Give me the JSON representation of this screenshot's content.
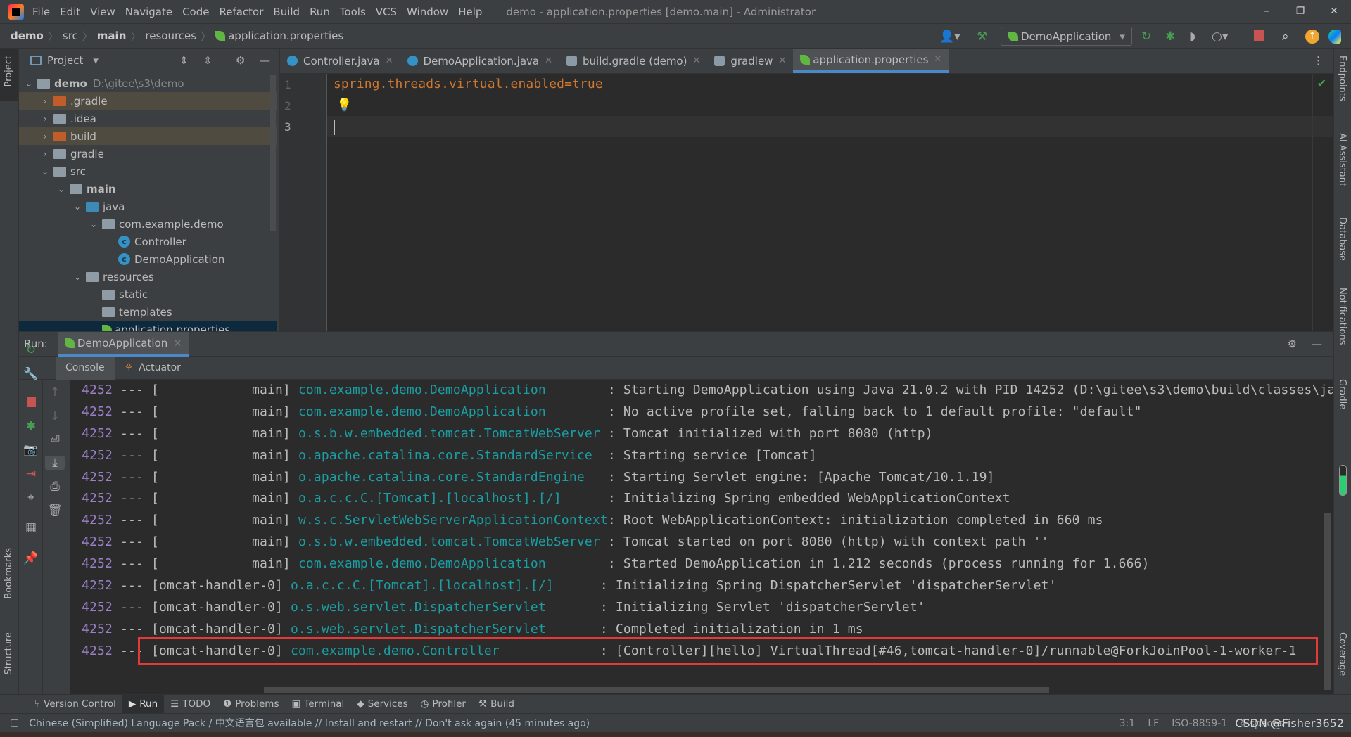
{
  "window": {
    "title": "demo - application.properties [demo.main] - Administrator",
    "menu": [
      "File",
      "Edit",
      "View",
      "Navigate",
      "Code",
      "Refactor",
      "Build",
      "Run",
      "Tools",
      "VCS",
      "Window",
      "Help"
    ],
    "controls": {
      "minimize": "–",
      "restore": "❐",
      "close": "✕"
    }
  },
  "breadcrumb": [
    "demo",
    "src",
    "main",
    "resources",
    "application.properties"
  ],
  "toolbar": {
    "run_config": "DemoApplication"
  },
  "project": {
    "header": "Project",
    "root": {
      "name": "demo",
      "path": "D:\\gitee\\s3\\demo"
    },
    "items": [
      {
        "label": ".gradle"
      },
      {
        "label": ".idea"
      },
      {
        "label": "build"
      },
      {
        "label": "gradle"
      },
      {
        "label": "src"
      },
      {
        "label": "main"
      },
      {
        "label": "java"
      },
      {
        "label": "com.example.demo"
      },
      {
        "label": "Controller"
      },
      {
        "label": "DemoApplication"
      },
      {
        "label": "resources"
      },
      {
        "label": "static"
      },
      {
        "label": "templates"
      },
      {
        "label": "application.properties"
      }
    ]
  },
  "editor": {
    "tabs": [
      {
        "label": "Controller.java"
      },
      {
        "label": "DemoApplication.java"
      },
      {
        "label": "build.gradle (demo)"
      },
      {
        "label": "gradlew"
      },
      {
        "label": "application.properties",
        "active": true
      }
    ],
    "line_numbers": [
      "1",
      "2",
      "3"
    ],
    "lines": [
      "spring.threads.virtual.enabled=true",
      "",
      ""
    ]
  },
  "run": {
    "label": "Run:",
    "tab": "DemoApplication",
    "subtabs": [
      "Console",
      "Actuator"
    ],
    "console": [
      [
        "4252 --- [",
        "            main] ",
        "com.example.demo.DemoApplication        ",
        ": Starting DemoApplication using Java 21.0.2 with PID 14252 (D:\\gitee\\s3\\demo\\build\\classes\\ja"
      ],
      [
        "4252 --- [",
        "            main] ",
        "com.example.demo.DemoApplication        ",
        ": No active profile set, falling back to 1 default profile: \"default\""
      ],
      [
        "4252 --- [",
        "            main] ",
        "o.s.b.w.embedded.tomcat.TomcatWebServer ",
        ": Tomcat initialized with port 8080 (http)"
      ],
      [
        "4252 --- [",
        "            main] ",
        "o.apache.catalina.core.StandardService  ",
        ": Starting service [Tomcat]"
      ],
      [
        "4252 --- [",
        "            main] ",
        "o.apache.catalina.core.StandardEngine   ",
        ": Starting Servlet engine: [Apache Tomcat/10.1.19]"
      ],
      [
        "4252 --- [",
        "            main] ",
        "o.a.c.c.C.[Tomcat].[localhost].[/]      ",
        ": Initializing Spring embedded WebApplicationContext"
      ],
      [
        "4252 --- [",
        "            main] ",
        "w.s.c.ServletWebServerApplicationContext",
        ": Root WebApplicationContext: initialization completed in 660 ms"
      ],
      [
        "4252 --- [",
        "            main] ",
        "o.s.b.w.embedded.tomcat.TomcatWebServer ",
        ": Tomcat started on port 8080 (http) with context path ''"
      ],
      [
        "4252 --- [",
        "            main] ",
        "com.example.demo.DemoApplication        ",
        ": Started DemoApplication in 1.212 seconds (process running for 1.666)"
      ],
      [
        "4252 --- [",
        "omcat-handler-0] ",
        "o.a.c.c.C.[Tomcat].[localhost].[/]      ",
        ": Initializing Spring DispatcherServlet 'dispatcherServlet'"
      ],
      [
        "4252 --- [",
        "omcat-handler-0] ",
        "o.s.web.servlet.DispatcherServlet       ",
        ": Initializing Servlet 'dispatcherServlet'"
      ],
      [
        "4252 --- [",
        "omcat-handler-0] ",
        "o.s.web.servlet.DispatcherServlet       ",
        ": Completed initialization in 1 ms"
      ],
      [
        "4252 --- [",
        "omcat-handler-0] ",
        "com.example.demo.Controller             ",
        ": [Controller][hello] VirtualThread[#46,tomcat-handler-0]/runnable@ForkJoinPool-1-worker-1"
      ]
    ],
    "highlight_color": "#e53935"
  },
  "left_stripe": [
    "Project",
    "Bookmarks",
    "Structure"
  ],
  "right_stripe": [
    "Endpoints",
    "AI Assistant",
    "Database",
    "Notifications",
    "Gradle",
    "Coverage"
  ],
  "bottom_tools": [
    "Version Control",
    "Run",
    "TODO",
    "Problems",
    "Terminal",
    "Services",
    "Profiler",
    "Build"
  ],
  "status": {
    "message": "Chinese (Simplified) Language Pack / 中文语言包 available // Install and restart // Don't ask again (45 minutes ago)",
    "position": "3:1",
    "line_sep": "LF",
    "encoding": "ISO-8859-1",
    "indent": "4 spaces",
    "watermark": "CSDN @Fisher3652"
  },
  "colors": {
    "pid": "#9a80c8",
    "logger": "#1a9ea3",
    "property": "#cc7832",
    "accent": "#4a88c7"
  }
}
